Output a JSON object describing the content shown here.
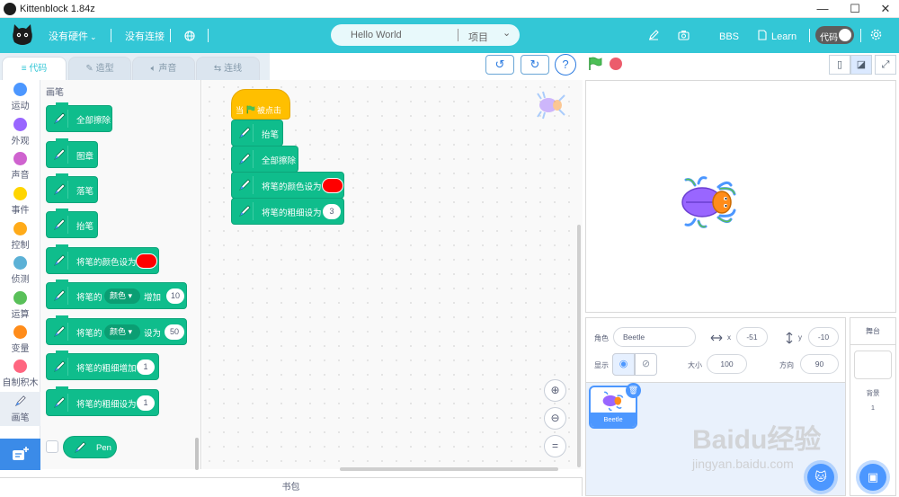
{
  "window": {
    "title": "Kittenblock 1.84z",
    "controls": [
      "—",
      "☐",
      "✕"
    ]
  },
  "menubar": {
    "hardware": "没有硬件",
    "connection": "没有连接",
    "project_name": "Hello World",
    "project_menu": "项目",
    "bbs": "BBS",
    "learn": "Learn",
    "code_toggle": "代码"
  },
  "tabs": [
    {
      "label": "代码",
      "active": true
    },
    {
      "label": "造型",
      "active": false
    },
    {
      "label": "声音",
      "active": false
    },
    {
      "label": "连线",
      "active": false
    }
  ],
  "categories": [
    {
      "label": "运动",
      "color": "#4c97ff"
    },
    {
      "label": "外观",
      "color": "#9966ff"
    },
    {
      "label": "声音",
      "color": "#cf63cf"
    },
    {
      "label": "事件",
      "color": "#ffd500"
    },
    {
      "label": "控制",
      "color": "#ffab19"
    },
    {
      "label": "侦测",
      "color": "#5cb1d6"
    },
    {
      "label": "运算",
      "color": "#59c059"
    },
    {
      "label": "变量",
      "color": "#ff8c1a"
    },
    {
      "label": "自制积木",
      "color": "#ff6680"
    },
    {
      "label": "画笔",
      "color": "#0fbd8c"
    }
  ],
  "palette": {
    "heading": "画笔",
    "blocks": {
      "clear": "全部擦除",
      "stamp": "图章",
      "pen_down": "落笔",
      "pen_up": "抬笔",
      "set_color": "将笔的颜色设为",
      "change_param_prefix": "将笔的",
      "change_param_dropdown": "颜色",
      "change_param_suffix": "增加",
      "change_param_value": "10",
      "set_param_prefix": "将笔的",
      "set_param_dropdown": "颜色",
      "set_param_suffix": "设为",
      "set_param_value": "50",
      "change_size": "将笔的粗细增加",
      "change_size_value": "1",
      "set_size": "将笔的粗细设为",
      "set_size_value": "1"
    },
    "pen_reporter": "Pen"
  },
  "script": {
    "hat_prefix": "当",
    "hat_suffix": "被点击",
    "pen_up": "抬笔",
    "clear": "全部擦除",
    "set_color": "将笔的颜色设为",
    "set_size": "将笔的粗细设为",
    "set_size_value": "3"
  },
  "sprite_info": {
    "sprite_label": "角色",
    "sprite_name": "Beetle",
    "x_label": "x",
    "x_value": "-51",
    "y_label": "y",
    "y_value": "-10",
    "show_label": "显示",
    "size_label": "大小",
    "size_value": "100",
    "direction_label": "方向",
    "direction_value": "90"
  },
  "sprite_list": [
    {
      "name": "Beetle",
      "selected": true
    }
  ],
  "backdrop": {
    "header": "舞台",
    "label": "背景",
    "count": "1"
  },
  "backpack": "书包",
  "watermark": {
    "line1": "Baidu经验",
    "line2": "jingyan.baidu.com"
  },
  "colors": {
    "menubar": "#33c7d6",
    "pen_block": "#0fbd8c",
    "event_block": "#ffbf00",
    "accent_blue": "#4c97ff"
  }
}
